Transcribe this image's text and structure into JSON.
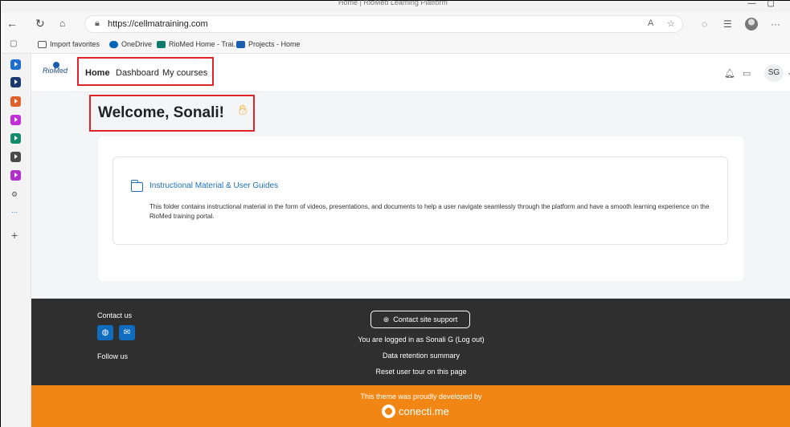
{
  "browser": {
    "window_title": "Home | RioMed Learning Platform",
    "url": "https://cellmatraining.com",
    "favorites": [
      {
        "label": "Import favorites"
      },
      {
        "label": "OneDrive"
      },
      {
        "label": "RioMed Home - Trai..."
      },
      {
        "label": "Projects - Home"
      }
    ]
  },
  "site": {
    "logo_text": "RioMed",
    "nav": {
      "home": "Home",
      "dashboard": "Dashboard",
      "my_courses": "My courses"
    },
    "user_initials": "SG"
  },
  "main": {
    "welcome": "Welcome, Sonali!",
    "activity": {
      "title": "Instructional Material & User Guides",
      "description": "This folder contains instructional material in the form of videos, presentations, and documents to help a user navigate seamlessly through the platform and have a smooth learning experience on the RioMed training portal."
    }
  },
  "footer": {
    "contact_us": "Contact us",
    "follow_us": "Follow us",
    "support_button": "Contact site support",
    "logged_in": "You are logged in as Sonali G (Log out)",
    "data_retention": "Data retention summary",
    "reset_tour": "Reset user tour on this page",
    "credit": "This theme was proudly developed by",
    "brand": "conecti.me"
  },
  "colors": {
    "accent": "#0f6cbf",
    "footer_dark": "#2f2f2f",
    "footer_orange": "#f28614",
    "highlight": "#e0242a"
  }
}
